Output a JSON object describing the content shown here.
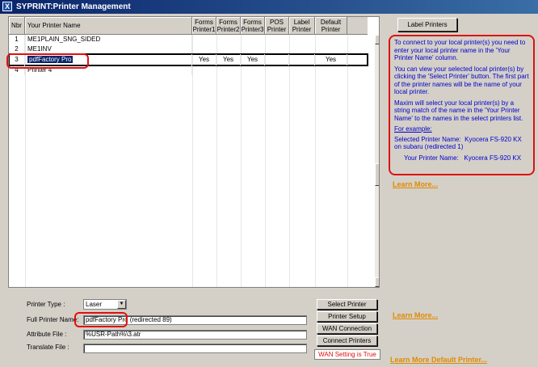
{
  "window": {
    "title": "SYPRINT:Printer Management",
    "icon": "app-x-icon"
  },
  "grid": {
    "columns": [
      {
        "label": "Nbr"
      },
      {
        "label": "Your Printer Name"
      },
      {
        "label": "Forms Printer1"
      },
      {
        "label": "Forms Printer2"
      },
      {
        "label": "Forms Printer3"
      },
      {
        "label": "POS Printer"
      },
      {
        "label": "Label Printer"
      },
      {
        "label": "Default Printer"
      }
    ],
    "rows": [
      {
        "nbr": "1",
        "name": "ME1PLAIN_SNG_SIDED",
        "f1": "",
        "f2": "",
        "f3": "",
        "pos": "",
        "label": "",
        "def": ""
      },
      {
        "nbr": "2",
        "name": "ME1INV",
        "f1": "",
        "f2": "",
        "f3": "",
        "pos": "",
        "label": "",
        "def": ""
      },
      {
        "nbr": "3",
        "name": "pdfFactory Pro",
        "f1": "Yes",
        "f2": "Yes",
        "f3": "Yes",
        "pos": "",
        "label": "",
        "def": "Yes"
      },
      {
        "nbr": "4",
        "name": "Printer 4",
        "f1": "",
        "f2": "",
        "f3": "",
        "pos": "",
        "label": "",
        "def": ""
      }
    ],
    "selected_row": 3
  },
  "form": {
    "printer_type_label": "Printer Type :",
    "printer_type_value": "Laser",
    "full_printer_name_label": "Full Printer Name:",
    "full_printer_name_value": "pdfFactory Pro",
    "full_printer_name_suffix": " (redirected 89)",
    "attribute_file_label": "Attribute File :",
    "attribute_file_value": "%USR-Path%\\3.atr",
    "translate_file_label": "Translate File :",
    "translate_file_value": ""
  },
  "buttons": {
    "select_printer": "Select Printer",
    "printer_setup": "Printer Setup",
    "wan_connection": "WAN Connection",
    "connect_printers": "Connect Printers",
    "label_printers": "Label Printers"
  },
  "status": {
    "wan": "WAN Setting is True"
  },
  "info": {
    "p1": "To connect to your local printer(s) you need to enter your local printer name in the 'Your Printer Name' column.",
    "p2": "You can view your selected local printer(s) by clicking the 'Select Printer' button. The first part of the printer names will be the name of your local printer.",
    "p3": "Maxim will select your local printer(s) by  a string match of the name in the 'Your Printer Name' to the names in the select printers list.",
    "example_heading": "For example:",
    "ex1_label": "Selected Printer Name:",
    "ex1_value": "Kyocera FS-920 KX on subaru (redirected 1)",
    "ex2_label": "Your Printer Name:",
    "ex2_value": "Kyocera FS-920 KX"
  },
  "links": {
    "learn_more_1": "Learn More...",
    "learn_more_2": "Learn More...",
    "learn_more_default": "Learn More Default Printer..."
  },
  "colors": {
    "annotation_red": "#e01010",
    "info_blue": "#0000cc",
    "link_orange": "#e08a00",
    "titlebar": "#0a246a"
  }
}
